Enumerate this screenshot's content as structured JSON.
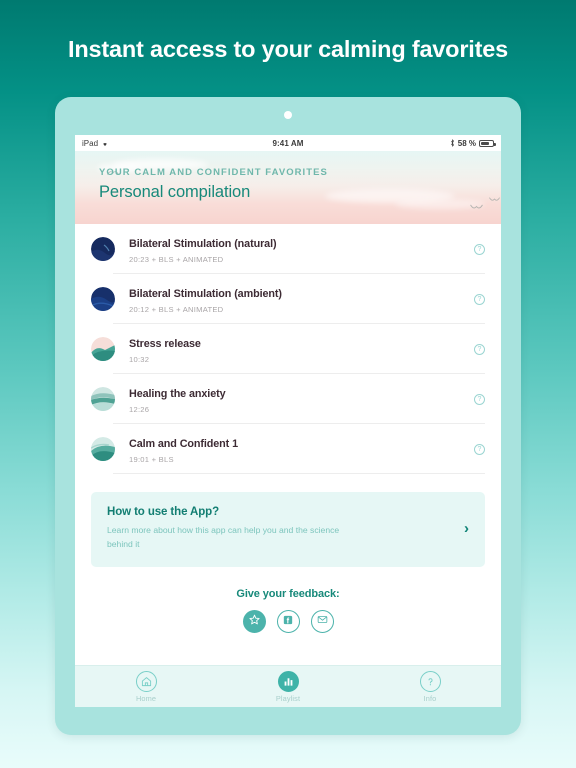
{
  "headline": "Instant access to your calming favorites",
  "status_bar": {
    "device": "iPad",
    "wifi_icon": "wifi-icon",
    "time": "9:41 AM",
    "bluetooth_icon": "bluetooth-icon",
    "battery_percent": "58 %",
    "battery_icon": "battery-icon"
  },
  "playlist_header": {
    "kicker": "YOUR CALM AND CONFIDENT FAVORITES",
    "title": "Personal compilation",
    "accent_color": "#17897a",
    "kicker_color": "#6fb7ab"
  },
  "tracks": [
    {
      "title": "Bilateral Stimulation (natural)",
      "meta": "20:23 + BLS + ANIMATED",
      "thumb_style": "navy",
      "info_icon": "question-circle-icon"
    },
    {
      "title": "Bilateral Stimulation (ambient)",
      "meta": "20:12 + BLS + ANIMATED",
      "thumb_style": "navy",
      "info_icon": "question-circle-icon"
    },
    {
      "title": "Stress release",
      "meta": "10:32",
      "thumb_style": "pink-teal",
      "info_icon": "question-circle-icon"
    },
    {
      "title": "Healing the anxiety",
      "meta": "12:26",
      "thumb_style": "teal-waves",
      "info_icon": "question-circle-icon"
    },
    {
      "title": "Calm and Confident 1",
      "meta": "19:01 + BLS",
      "thumb_style": "teal-waves",
      "info_icon": "question-circle-icon"
    }
  ],
  "info_card": {
    "title": "How to use the App?",
    "subtitle": "Learn more about how this app can help you and the science behind it",
    "chevron": "›",
    "background": "#e6f7f5"
  },
  "feedback": {
    "title": "Give your feedback:",
    "buttons": [
      {
        "name": "rate-star-button",
        "icon": "star-icon",
        "filled": true
      },
      {
        "name": "facebook-button",
        "icon": "facebook-icon",
        "filled": false
      },
      {
        "name": "email-button",
        "icon": "envelope-icon",
        "filled": false
      }
    ]
  },
  "tabbar": {
    "items": [
      {
        "label": "Home",
        "icon": "home-icon",
        "active": false
      },
      {
        "label": "Playlist",
        "icon": "bar-chart-icon",
        "active": true
      },
      {
        "label": "Info",
        "icon": "question-mark-icon",
        "active": false
      }
    ]
  },
  "colors": {
    "background_top": "#007a70",
    "background_bottom": "#e9fcfb",
    "device_frame": "#a8e3de",
    "accent_teal": "#3fb3a8",
    "track_title": "#3d2b34",
    "track_meta": "#a9a5a7"
  }
}
